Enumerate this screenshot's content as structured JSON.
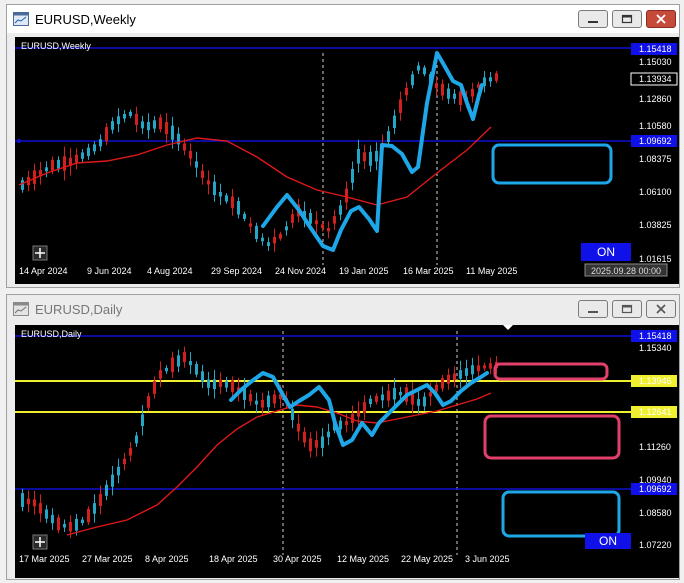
{
  "weekly": {
    "title": "EURUSD,Weekly",
    "chart_label": "EURUSD,Weekly",
    "prices": [
      "1.15418",
      "1.15030",
      "1.13934",
      "1.12860",
      "1.10580",
      "1.09692",
      "1.08375",
      "1.06100",
      "1.03825",
      "1.01615"
    ],
    "dates": [
      "14 Apr 2024",
      "9 Jun 2024",
      "4 Aug 2024",
      "29 Sep 2024",
      "24 Nov 2024",
      "19 Jan 2025",
      "16 Mar 2025",
      "11 May 2025"
    ],
    "cursor_date": "2025.09.28 00:00",
    "on_label": "ON"
  },
  "daily": {
    "title": "EURUSD,Daily",
    "chart_label": "EURUSD,Daily",
    "prices": [
      "1.15418",
      "1.15340",
      "1.13946",
      "1.12641",
      "1.11260",
      "1.09940",
      "1.09692",
      "1.08580",
      "1.07220"
    ],
    "dates": [
      "17 Mar 2025",
      "27 Mar 2025",
      "8 Apr 2025",
      "18 Apr 2025",
      "30 Apr 2025",
      "12 May 2025",
      "22 May 2025",
      "3 Jun 2025"
    ],
    "on_label": "ON"
  },
  "colors": {
    "bull": "#26a6c6",
    "bear": "#d21f1f",
    "ma": "#e01818",
    "drawing": "#1ea7e8",
    "level": "#1010d0",
    "support": "#f0f030",
    "box_red": "#e0406a"
  },
  "icons": {
    "app": "chart-window-icon",
    "minimize": "minimize-icon",
    "restore": "restore-icon",
    "close": "close-icon",
    "crosshair": "crosshair-icon"
  }
}
